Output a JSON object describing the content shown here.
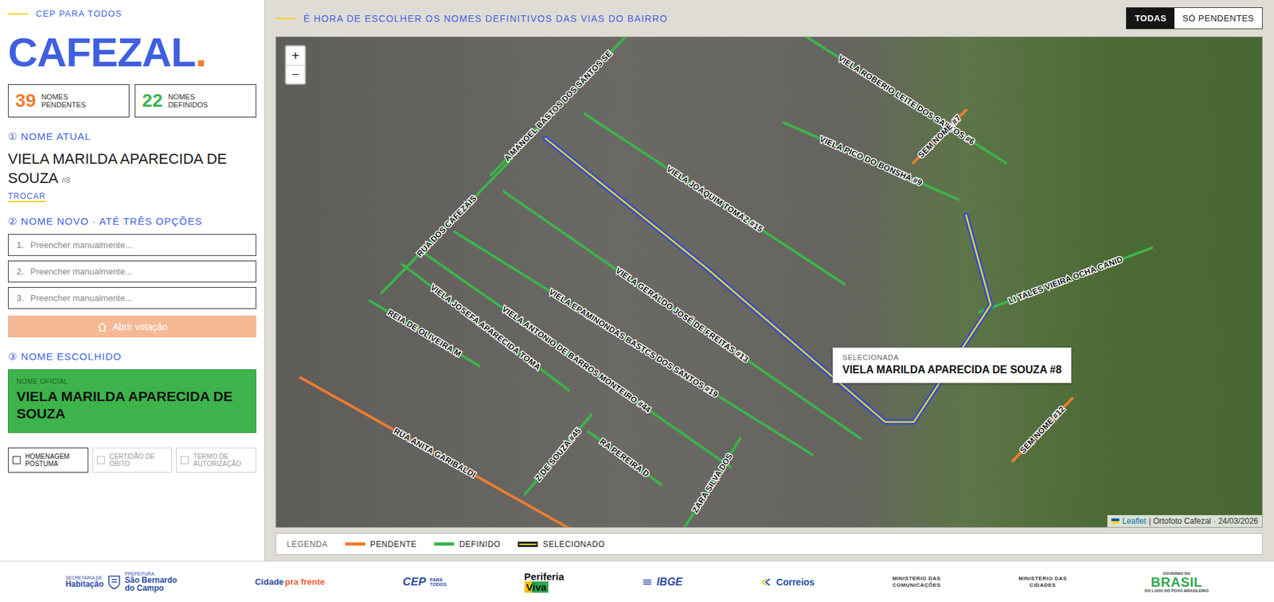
{
  "brand": {
    "kicker": "CEP PARA TODOS",
    "word": "CAFEZAL",
    "dot": "."
  },
  "stats": [
    {
      "value": "39",
      "label": "NOMES PENDENTES",
      "status": "pendente"
    },
    {
      "value": "22",
      "label": "NOMES DEFINIDOS",
      "status": "definido"
    }
  ],
  "current": {
    "title": "① NOME ATUAL",
    "name": "VIELA MARILDA APARECIDA DE SOUZA",
    "tag": "#8",
    "link": "TROCAR"
  },
  "new_name": {
    "title": "② NOME NOVO · ATÉ TRÊS OPÇÕES",
    "options": [
      {
        "number": "1.",
        "placeholder": "Preencher manualmente..."
      },
      {
        "number": "2.",
        "placeholder": "Preencher manualmente..."
      },
      {
        "number": "3.",
        "placeholder": "Preencher manualmente..."
      }
    ],
    "button": "Abrir votação"
  },
  "chosen": {
    "title": "③ NOME ESCOLHIDO",
    "label": "NOME OFICIAL",
    "name": "VIELA MARILDA APARECIDA DE SOUZA"
  },
  "checks": [
    {
      "label": "HOMENAGEM PÓSTUMA",
      "checked": false,
      "disabled": false
    },
    {
      "label": "CERTIDÃO DE ÓBITO",
      "checked": false,
      "disabled": true
    },
    {
      "label": "TERMO DE AUTORIZAÇÃO",
      "checked": false,
      "disabled": true
    }
  ],
  "header": {
    "title": "É HORA DE ESCOLHER OS NOMES DEFINITIVOS DAS VIAS DO BAIRRO",
    "filters": [
      {
        "label": "TODAS",
        "selected": true
      },
      {
        "label": "SÓ PENDENTES",
        "selected": false
      }
    ]
  },
  "map": {
    "zoom": [
      "+",
      "−"
    ],
    "streets": [
      {
        "label": "A MANOEL BASTOS DOS SANTOS SE",
        "status": "definido",
        "selected": false,
        "points": [
          [
            324,
            208
          ],
          [
            526,
            0
          ]
        ]
      },
      {
        "label": "RUA DOS CAFEZAIS",
        "status": "definido",
        "selected": false,
        "points": [
          [
            159,
            386
          ],
          [
            355,
            184
          ]
        ]
      },
      {
        "label": "VIELA JOAQUIM TOMAZ #15",
        "status": "definido",
        "selected": false,
        "points": [
          [
            465,
            116
          ],
          [
            857,
            373
          ]
        ]
      },
      {
        "label": "VIELA GERALDO JOSÉ DE FREITAS #13",
        "status": "definido",
        "selected": false,
        "points": [
          [
            343,
            233
          ],
          [
            881,
            606
          ]
        ]
      },
      {
        "label": "VIELA EPAMINONDAS BASTCS DOS SANTOS #19",
        "status": "definido",
        "selected": false,
        "points": [
          [
            269,
            294
          ],
          [
            808,
            630
          ]
        ]
      },
      {
        "label": "VIELA ANTONIO DE BARROS MONTEIRO #44",
        "status": "definido",
        "selected": false,
        "points": [
          [
            220,
            324
          ],
          [
            685,
            649
          ]
        ]
      },
      {
        "label": "VIELA JOSEFA APARECIDA TOMA",
        "status": "definido",
        "selected": false,
        "points": [
          [
            190,
            343
          ],
          [
            441,
            533
          ]
        ]
      },
      {
        "label": "REIA DE OLIVEIRA M",
        "status": "definido",
        "selected": false,
        "points": [
          [
            141,
            398
          ],
          [
            306,
            496
          ]
        ]
      },
      {
        "label": "VIELA ROBERIO LEITE DOS SANTOS #6",
        "status": "definido",
        "selected": false,
        "points": [
          [
            800,
            0
          ],
          [
            1100,
            190
          ]
        ]
      },
      {
        "label": "VIELA PICO DO BONSHA #9",
        "status": "definido",
        "selected": false,
        "points": [
          [
            765,
            129
          ],
          [
            1028,
            245
          ]
        ]
      },
      {
        "label": "SEM NOME #7",
        "status": "pendente",
        "selected": false,
        "points": [
          [
            960,
            190
          ],
          [
            1040,
            110
          ]
        ]
      },
      {
        "label": "LI TALES VIEIRA OCHA CANID",
        "status": "definido",
        "selected": false,
        "points": [
          [
            1060,
            415
          ],
          [
            1320,
            318
          ]
        ]
      },
      {
        "label": "SEM NOME #12",
        "status": "pendente",
        "selected": false,
        "points": [
          [
            1110,
            640
          ],
          [
            1200,
            545
          ]
        ]
      },
      {
        "label": "RUA ANITA GARIBALDI",
        "status": "pendente",
        "selected": false,
        "points": [
          [
            37,
            514
          ],
          [
            441,
            741
          ]
        ]
      },
      {
        "label": "Z DE SOUZA #45",
        "status": "definido",
        "selected": false,
        "points": [
          [
            375,
            690
          ],
          [
            475,
            570
          ]
        ]
      },
      {
        "label": "RA PEREIRA D",
        "status": "definido",
        "selected": false,
        "points": [
          [
            470,
            595
          ],
          [
            580,
            675
          ]
        ]
      },
      {
        "label": "ZARA SILVA DOS",
        "status": "definido",
        "selected": false,
        "points": [
          [
            615,
            741
          ],
          [
            700,
            605
          ]
        ]
      },
      {
        "status": "definido",
        "selected": true,
        "points": [
          [
            406,
            153
          ],
          [
            649,
            349
          ],
          [
            918,
            581
          ],
          [
            961,
            581
          ],
          [
            1077,
            404
          ],
          [
            1040,
            269
          ]
        ]
      }
    ],
    "tooltip": {
      "label": "SELECIONADA",
      "name": "VIELA MARILDA APARECIDA DE SOUZA #8"
    },
    "attribution": {
      "link": "Leaflet",
      "text": "| Ortofoto Cafezal · 24/03/2026"
    }
  },
  "legend": {
    "title": "LEGENDA",
    "items": [
      {
        "label": "PENDENTE",
        "status": "pendente",
        "color": "#ef7d2f"
      },
      {
        "label": "DEFINIDO",
        "status": "definido",
        "color": "#3cb44b"
      },
      {
        "label": "SELECIONADO",
        "status": "selecionado",
        "color": "#2f4fd8"
      }
    ]
  },
  "footer": [
    {
      "kind": "sbc",
      "texts": [
        "SECRETARIA DE",
        "Habitação",
        "PREFEITURA",
        "São Bernardo",
        "do Campo"
      ]
    },
    {
      "kind": "cidade",
      "texts": [
        "Cidade",
        "pra frente"
      ]
    },
    {
      "kind": "cep",
      "texts": [
        "CEP",
        "PARA",
        "TODOS"
      ]
    },
    {
      "kind": "periferia",
      "texts": [
        "Periferia",
        "Viva"
      ]
    },
    {
      "kind": "ibge",
      "texts": [
        "IBGE"
      ]
    },
    {
      "kind": "correios",
      "texts": [
        "Correios"
      ]
    },
    {
      "kind": "ministerio",
      "texts": [
        "MINISTÉRIO DAS",
        "COMUNICAÇÕES"
      ]
    },
    {
      "kind": "ministerio",
      "texts": [
        "MINISTÉRIO DAS",
        "CIDADES"
      ]
    },
    {
      "kind": "brasil",
      "texts": [
        "GOVERNO DO",
        "BRASIL",
        "DO LADO DO POVO BRASILEIRO"
      ]
    }
  ]
}
